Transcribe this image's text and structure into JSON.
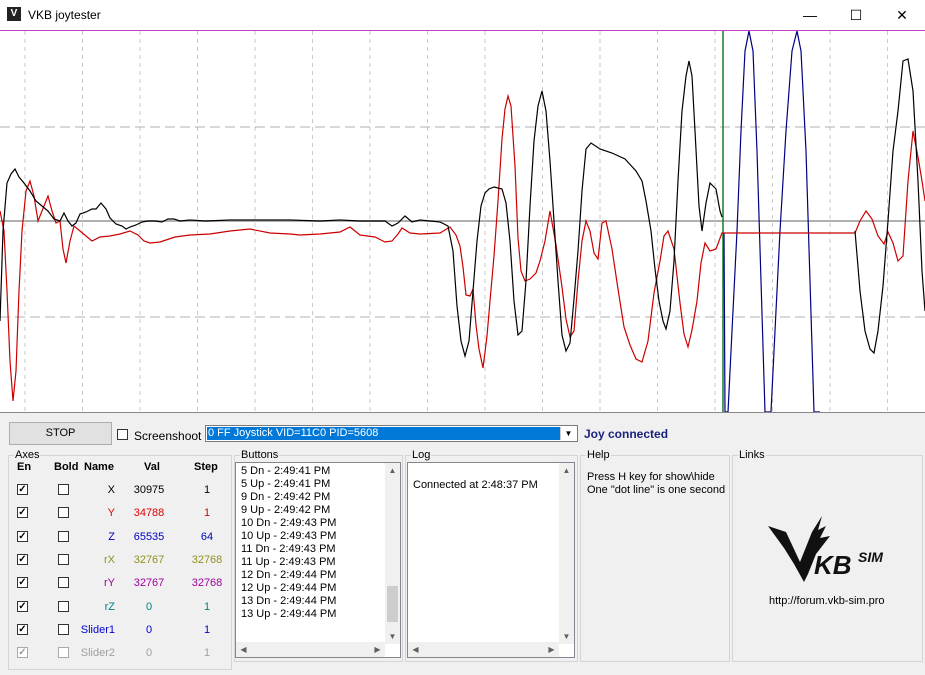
{
  "window": {
    "title": "VKB joytester",
    "app_icon_label": "V",
    "minimize": "—",
    "maximize": "☐",
    "close": "✕"
  },
  "toolbar": {
    "stop_label": "STOP",
    "screenshot_label": "Screenshoot",
    "screenshot_checked": false,
    "device_selected": "0 FF  Joystick  VID=11C0 PID=5608",
    "status": "Joy connected"
  },
  "axes": {
    "group_title": "Axes",
    "headers": {
      "en": "En",
      "bold": "Bold",
      "name": "Name",
      "val": "Val",
      "step": "Step"
    },
    "rows": [
      {
        "name": "X",
        "val": "30975",
        "step": "1",
        "color": "#000000",
        "enabled": true,
        "bold": false
      },
      {
        "name": "Y",
        "val": "34788",
        "step": "1",
        "color": "#e00000",
        "enabled": true,
        "bold": false
      },
      {
        "name": "Z",
        "val": "65535",
        "step": "64",
        "color": "#0000c0",
        "enabled": true,
        "bold": false
      },
      {
        "name": "rX",
        "val": "32767",
        "step": "32768",
        "color": "#909020",
        "enabled": true,
        "bold": false
      },
      {
        "name": "rY",
        "val": "32767",
        "step": "32768",
        "color": "#a000a0",
        "enabled": true,
        "bold": false
      },
      {
        "name": "rZ",
        "val": "0",
        "step": "1",
        "color": "#008080",
        "enabled": true,
        "bold": false
      },
      {
        "name": "Slider1",
        "val": "0",
        "step": "1",
        "color": "#0000d0",
        "enabled": true,
        "bold": false
      },
      {
        "name": "Slider2",
        "val": "0",
        "step": "1",
        "color": "#a0a0a0",
        "enabled": true,
        "bold": false
      }
    ]
  },
  "buttons": {
    "group_title": "Buttons",
    "items": [
      "5 Dn - 2:49:41 PM",
      "5 Up - 2:49:41 PM",
      "9 Dn - 2:49:42 PM",
      "9 Up - 2:49:42 PM",
      "10 Dn - 2:49:43 PM",
      "10 Up - 2:49:43 PM",
      "11 Dn - 2:49:43 PM",
      "11 Up - 2:49:43 PM",
      "12 Dn - 2:49:44 PM",
      "12 Up - 2:49:44 PM",
      "13 Dn - 2:49:44 PM",
      "13 Up - 2:49:44 PM"
    ]
  },
  "log": {
    "group_title": "Log",
    "text": "Connected at 2:48:37 PM"
  },
  "help": {
    "group_title": "Help",
    "line1": "Press H key for show\\hide",
    "line2": "One \"dot line\" is one second"
  },
  "links": {
    "group_title": "Links",
    "logo_text": "VKBSIM",
    "url": "http://forum.vkb-sim.pro"
  },
  "graph": {
    "x_color": "#000000",
    "y_color": "#cc0000",
    "z_color": "#000080",
    "marker_color": "#008000"
  }
}
